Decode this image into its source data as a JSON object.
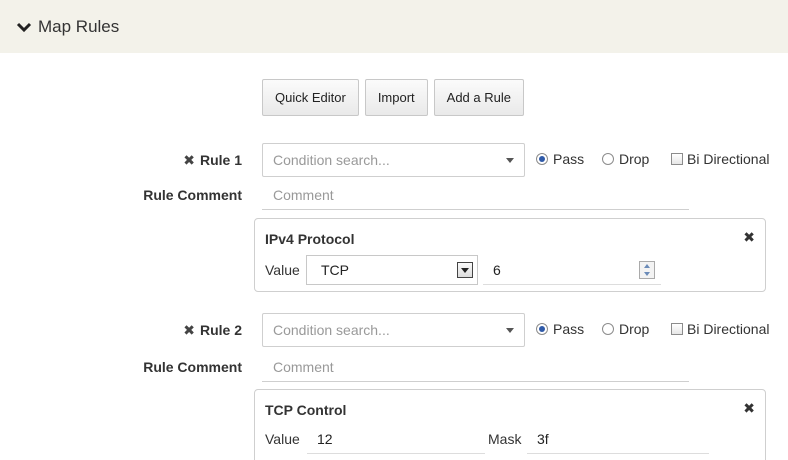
{
  "section": {
    "title": "Map Rules"
  },
  "toolbar": {
    "quick_editor": "Quick Editor",
    "import": "Import",
    "add_rule": "Add a Rule"
  },
  "labels": {
    "rule_comment": "Rule Comment"
  },
  "rules": [
    {
      "label": "Rule 1",
      "condition_placeholder": "Condition search...",
      "pass": "Pass",
      "drop": "Drop",
      "bidir": "Bi Directional",
      "pass_selected": true,
      "bidir_checked": false,
      "comment_placeholder": "Comment",
      "condition": {
        "title": "IPv4 Protocol",
        "value_label": "Value",
        "protocol": "TCP",
        "number": "6"
      }
    },
    {
      "label": "Rule 2",
      "condition_placeholder": "Condition search...",
      "pass": "Pass",
      "drop": "Drop",
      "bidir": "Bi Directional",
      "pass_selected": true,
      "bidir_checked": false,
      "comment_placeholder": "Comment",
      "condition": {
        "title": "TCP Control",
        "value_label": "Value",
        "value": "12",
        "mask_label": "Mask",
        "mask": "3f"
      }
    }
  ],
  "icons": {
    "collapse": "chevron-down-icon",
    "remove": "close-icon",
    "dropdown": "caret-down-icon",
    "spinner": "spinner-icon"
  },
  "colors": {
    "header_bg": "#f3f2ea",
    "radio_selected": "#2f5aa8"
  }
}
